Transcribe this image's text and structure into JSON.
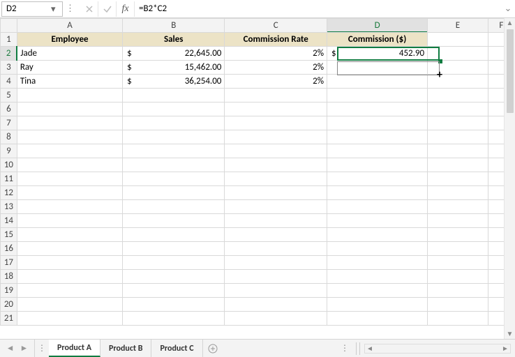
{
  "formulaBar": {
    "nameBox": "D2",
    "formula": "=B2*C2"
  },
  "columns": [
    "A",
    "B",
    "C",
    "D",
    "E",
    "F"
  ],
  "headers": {
    "A": "Employee",
    "B": "Sales",
    "C": "Commission Rate",
    "D": "Commission ($)"
  },
  "rows": [
    {
      "employee": "Jade",
      "salesSym": "$",
      "salesVal": "22,645.00",
      "rate": "2%",
      "commSym": "$",
      "commVal": "452.90"
    },
    {
      "employee": "Ray",
      "salesSym": "$",
      "salesVal": "15,462.00",
      "rate": "2%",
      "commSym": "",
      "commVal": ""
    },
    {
      "employee": "Tina",
      "salesSym": "$",
      "salesVal": "36,254.00",
      "rate": "2%",
      "commSym": "",
      "commVal": ""
    }
  ],
  "emptyRowStart": 5,
  "emptyRowEnd": 21,
  "tabs": [
    "Product A",
    "Product B",
    "Product C"
  ],
  "activeTab": 0,
  "icons": {
    "fbDots": "⋮",
    "dropdown": "▾",
    "cancel": "✕",
    "confirm": "✓",
    "fx": "fx",
    "expand": "⌄",
    "navLeft": "◄",
    "navRight": "►",
    "newTab": "⊕",
    "scrollUp": "▲",
    "scrollDown": "▼"
  },
  "colWidths": {
    "row": 24,
    "A": 158,
    "B": 152,
    "C": 150,
    "D": 148,
    "E": 92,
    "F": 40
  },
  "selection": {
    "col": "D",
    "row": 2
  },
  "chart_data": {
    "type": "table",
    "columns": [
      "Employee",
      "Sales",
      "Commission Rate",
      "Commission ($)"
    ],
    "rows": [
      [
        "Jade",
        22645.0,
        0.02,
        452.9
      ],
      [
        "Ray",
        15462.0,
        0.02,
        null
      ],
      [
        "Tina",
        36254.0,
        0.02,
        null
      ]
    ]
  }
}
